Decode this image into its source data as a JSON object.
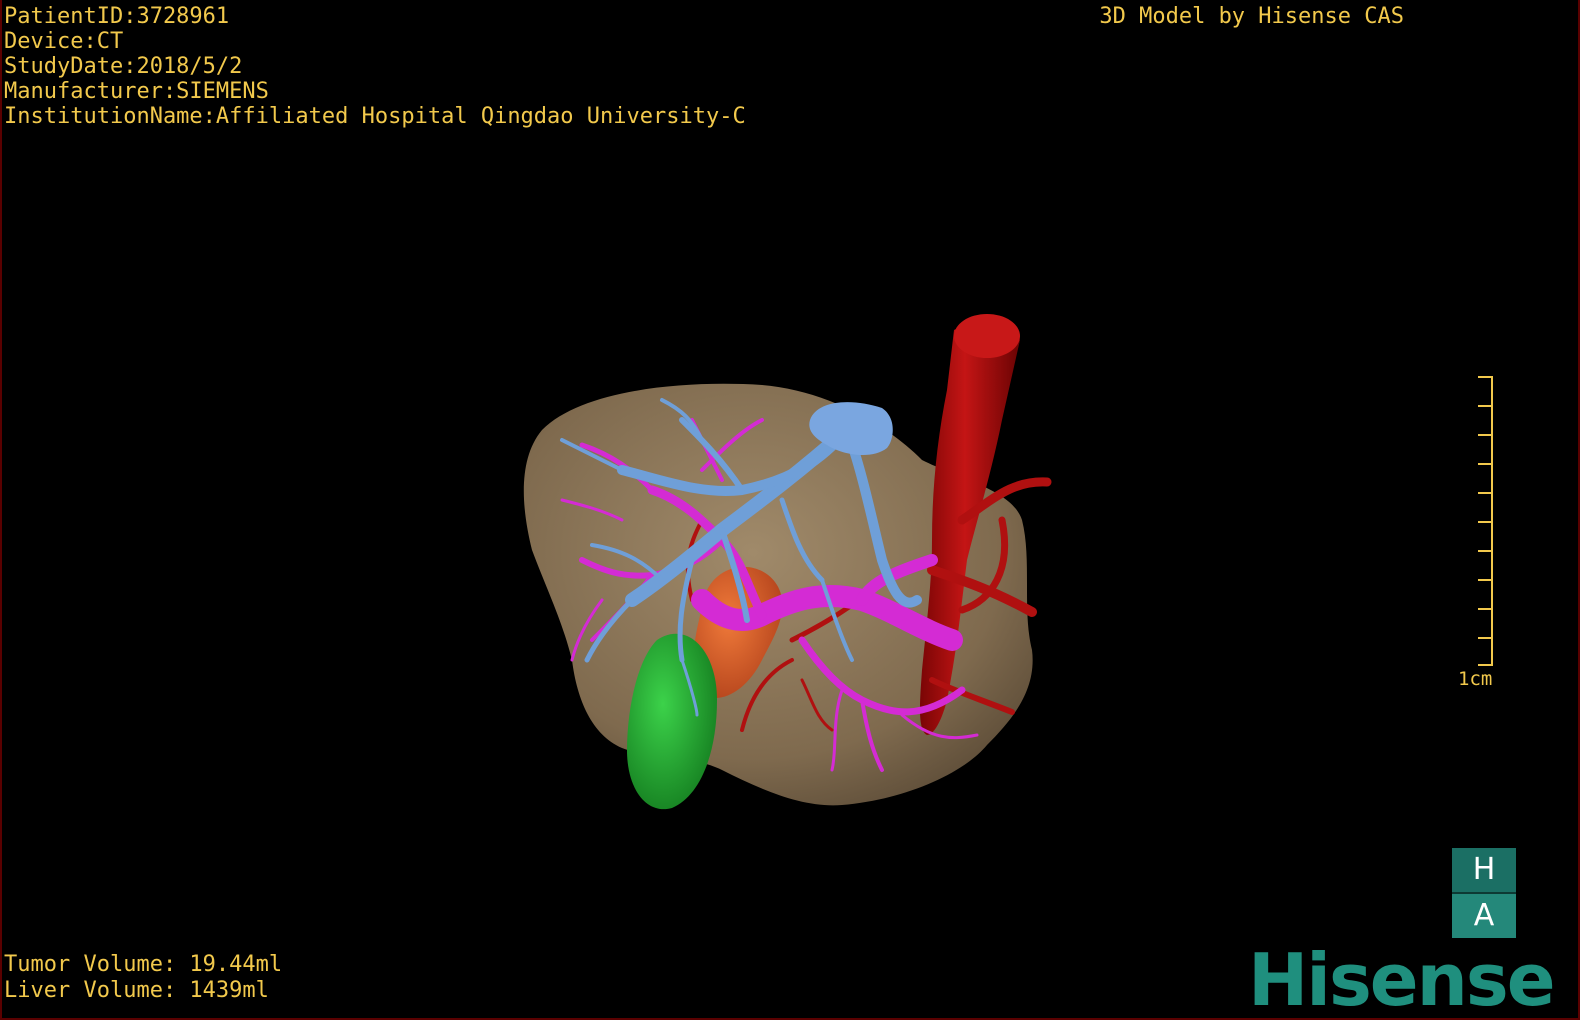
{
  "header": {
    "patient_id": "PatientID:3728961",
    "device": "Device:CT",
    "study_date": "StudyDate:2018/5/2",
    "manufacturer": "Manufacturer:SIEMENS",
    "institution": "InstitutionName:Affiliated Hospital Qingdao University-C"
  },
  "model_credit": "3D Model by Hisense CAS",
  "footer": {
    "tumor_volume": "Tumor Volume: 19.44ml",
    "liver_volume": "Liver Volume: 1439ml"
  },
  "scale": {
    "label": "1cm"
  },
  "orientation": {
    "top": "H",
    "bottom": "A"
  },
  "brand": "Hisense",
  "colors": {
    "overlay_text": "#f2c94c",
    "liver": "#8a7558",
    "hepatic_vein": "#6f9fd8",
    "portal_vein": "#d42bd4",
    "artery": "#b01010",
    "gallbladder": "#20b030",
    "tumor": "#e0602a",
    "brand": "#1f8f7e"
  }
}
